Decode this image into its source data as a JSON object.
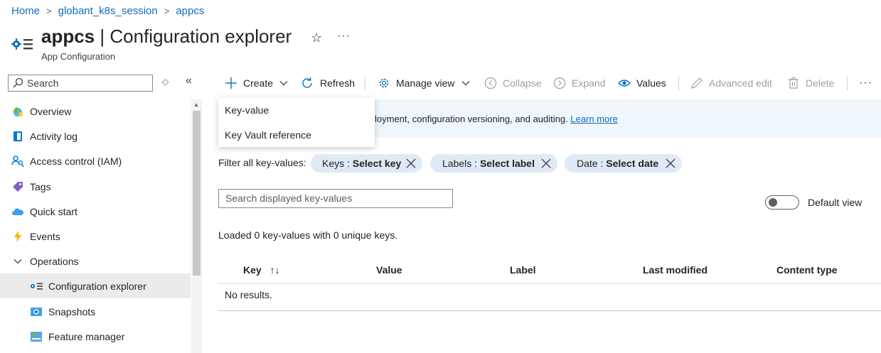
{
  "breadcrumb": [
    {
      "label": "Home"
    },
    {
      "label": "globant_k8s_session"
    },
    {
      "label": "appcs"
    }
  ],
  "header": {
    "resource_name": "appcs",
    "page_name": "Configuration explorer",
    "separator": "|",
    "subtitle": "App Configuration"
  },
  "sidebar": {
    "search_placeholder": "Search",
    "items": [
      {
        "label": "Overview",
        "icon": "overview-icon"
      },
      {
        "label": "Activity log",
        "icon": "activity-log-icon"
      },
      {
        "label": "Access control (IAM)",
        "icon": "iam-icon"
      },
      {
        "label": "Tags",
        "icon": "tag-icon"
      },
      {
        "label": "Quick start",
        "icon": "cloud-icon"
      },
      {
        "label": "Events",
        "icon": "lightning-icon"
      },
      {
        "label": "Operations",
        "icon": "chevron-down-icon"
      },
      {
        "label": "Configuration explorer",
        "icon": "config-explorer-icon"
      },
      {
        "label": "Snapshots",
        "icon": "snapshot-icon"
      },
      {
        "label": "Feature manager",
        "icon": "feature-manager-icon"
      }
    ]
  },
  "toolbar": {
    "create": "Create",
    "refresh": "Refresh",
    "manage_view": "Manage view",
    "collapse": "Collapse",
    "expand": "Expand",
    "values": "Values",
    "advanced_edit": "Advanced edit",
    "delete": "Delete"
  },
  "create_menu": {
    "items": [
      "Key-value",
      "Key Vault reference"
    ]
  },
  "banner": {
    "text": "loyment, configuration versioning, and auditing.",
    "link": "Learn more"
  },
  "filters": {
    "label": "Filter all key-values:",
    "pills": [
      {
        "name": "Keys",
        "sep": " : ",
        "value": "Select key"
      },
      {
        "name": "Labels",
        "sep": " : ",
        "value": "Select label"
      },
      {
        "name": "Date",
        "sep": " : ",
        "value": "Select date"
      }
    ]
  },
  "kv_search": {
    "placeholder": "Search displayed key-values"
  },
  "default_view": {
    "label": "Default view",
    "on": false
  },
  "status": {
    "loaded": "Loaded 0 key-values with 0 unique keys."
  },
  "table": {
    "columns": [
      "Key",
      "Value",
      "Label",
      "Last modified",
      "Content type"
    ],
    "empty_text": "No results."
  },
  "colors": {
    "accent": "#0f6cbd",
    "banner_bg": "#eff6fc",
    "pill_bg": "#dfeaf6",
    "selected_bg": "#ebebeb"
  }
}
